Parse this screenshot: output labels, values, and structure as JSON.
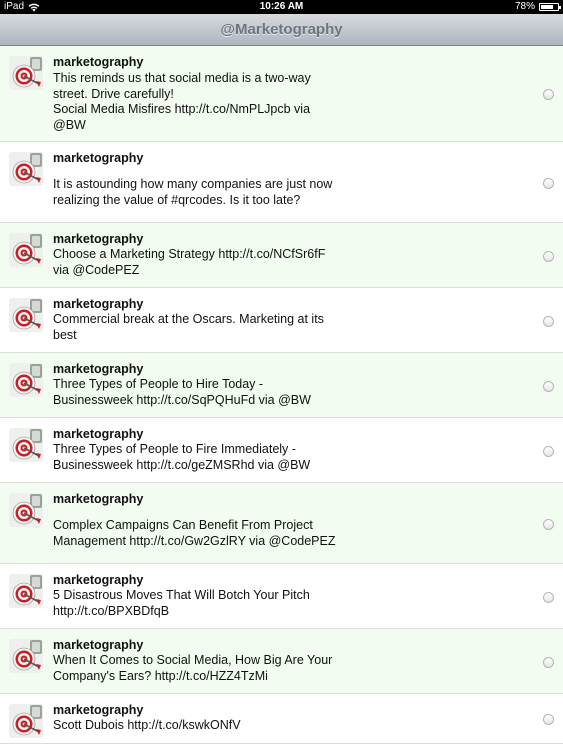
{
  "status": {
    "device": "iPad",
    "time": "10:26 AM",
    "battery": "78%",
    "battery_level": 0.78
  },
  "nav": {
    "title": "@Marketography"
  },
  "tweets": [
    {
      "user": "marketography",
      "text": "This reminds us that social media is a two-way\nstreet. Drive carefully!\nSocial Media Misfires http://t.co/NmPLJpcb via\n@BW"
    },
    {
      "user": "marketography",
      "text": "It is astounding how many companies are just now\nrealizing the value of #qrcodes. Is it too late?"
    },
    {
      "user": "marketography",
      "text": "Choose a Marketing Strategy http://t.co/NCfSr6fF\nvia @CodePEZ"
    },
    {
      "user": "marketography",
      "text": "Commercial break at the Oscars. Marketing at its\nbest"
    },
    {
      "user": "marketography",
      "text": "Three Types of People to Hire Today -\nBusinessweek http://t.co/SqPQHuFd via @BW"
    },
    {
      "user": "marketography",
      "text": "Three Types of People to Fire Immediately -\nBusinessweek http://t.co/geZMSRhd via @BW"
    },
    {
      "user": "marketography",
      "text": "Complex Campaigns Can Benefit From Project\nManagement http://t.co/Gw2GzlRY via @CodePEZ"
    },
    {
      "user": "marketography",
      "text": "5 Disastrous Moves That Will Botch Your Pitch\nhttp://t.co/BPXBDfqB"
    },
    {
      "user": "marketography",
      "text": "When It Comes to Social Media, How Big Are Your\nCompany's Ears? http://t.co/HZZ4TzMi"
    },
    {
      "user": "marketography",
      "text": "Scott Dubois http://t.co/kswkONfV"
    }
  ]
}
